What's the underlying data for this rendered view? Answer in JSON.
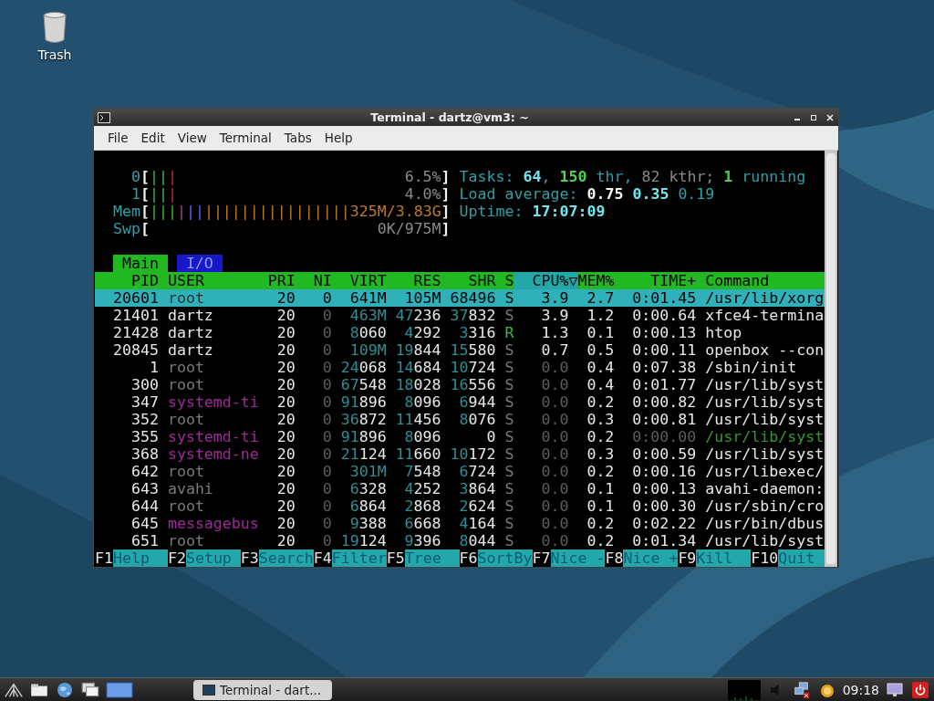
{
  "desktop_icons": [
    {
      "label": "Trash"
    }
  ],
  "window": {
    "title": "Terminal - dartz@vm3: ~",
    "menu": [
      "File",
      "Edit",
      "View",
      "Terminal",
      "Tabs",
      "Help"
    ]
  },
  "meters": [
    {
      "label": "0",
      "open": "[",
      "close": "]",
      "value": "6.5%",
      "segments": [
        {
          "kind": "normal",
          "text": "||"
        },
        {
          "kind": "kernel",
          "text": "|"
        }
      ]
    },
    {
      "label": "1",
      "open": "[",
      "close": "]",
      "value": "4.0%",
      "segments": [
        {
          "kind": "normal",
          "text": "||"
        },
        {
          "kind": "kernel",
          "text": "|"
        }
      ]
    },
    {
      "label": "Mem",
      "open": "[",
      "close": "]",
      "value": "325M/3.83G",
      "segments": [
        {
          "kind": "normal",
          "text": "|||"
        },
        {
          "kind": "shared",
          "text": "|"
        },
        {
          "kind": "buffers",
          "text": "||"
        },
        {
          "kind": "cache",
          "text": "||||||||||||||||"
        }
      ]
    },
    {
      "label": "Swp",
      "open": "[",
      "close": "]",
      "value": "0K/975M"
    }
  ],
  "info": [
    {
      "segments": [
        {
          "text": "Tasks: ",
          "kind": "label"
        },
        {
          "text": "64",
          "kind": "value"
        },
        {
          "text": ", ",
          "kind": "label"
        },
        {
          "text": "150",
          "kind": "green"
        },
        {
          "text": " thr, ",
          "kind": "label"
        },
        {
          "text": "82 kthr; ",
          "kind": "dim"
        },
        {
          "text": "1",
          "kind": "green"
        },
        {
          "text": " running",
          "kind": "label"
        }
      ]
    },
    {
      "segments": [
        {
          "text": "Load average: ",
          "kind": "label"
        },
        {
          "text": "0.75 ",
          "kind": "bright"
        },
        {
          "text": "0.35 ",
          "kind": "value"
        },
        {
          "text": "0.19",
          "kind": "label"
        }
      ]
    },
    {
      "segments": [
        {
          "text": "Uptime: ",
          "kind": "label"
        },
        {
          "text": "17:07:09",
          "kind": "value"
        }
      ]
    }
  ],
  "tabs": [
    {
      "label": "Main",
      "selected": true
    },
    {
      "label": "I/O",
      "selected": false
    }
  ],
  "table": {
    "columns": [
      {
        "label": "PID",
        "sorted": false
      },
      {
        "label": "USER",
        "sorted": false
      },
      {
        "label": "PRI",
        "sorted": false
      },
      {
        "label": "NI",
        "sorted": false
      },
      {
        "label": "VIRT",
        "sorted": false
      },
      {
        "label": "RES",
        "sorted": false
      },
      {
        "label": "SHR",
        "sorted": false
      },
      {
        "label": "S",
        "sorted": false
      },
      {
        "label": "CPU%▽",
        "sorted": true
      },
      {
        "label": "MEM%",
        "sorted": false
      },
      {
        "label": "TIME+",
        "sorted": false
      },
      {
        "label": "Command",
        "sorted": false
      }
    ],
    "rows": [
      {
        "cells": [
          "20601",
          "root",
          "20",
          "0",
          "641M",
          "105M",
          "68496",
          "S",
          "3.9",
          "2.7",
          "0:01.45",
          "/usr/lib/xorg"
        ],
        "selected": true,
        "running": false,
        "thread": false,
        "kind": "other"
      },
      {
        "cells": [
          "21401",
          "dartz",
          "20",
          "0",
          "463M",
          "47236",
          "37832",
          "S",
          "3.9",
          "1.2",
          "0:00.64",
          "xfce4-termina"
        ],
        "selected": false,
        "running": false,
        "thread": false,
        "kind": "self"
      },
      {
        "cells": [
          "21428",
          "dartz",
          "20",
          "0",
          "8060",
          "4292",
          "3316",
          "R",
          "1.3",
          "0.1",
          "0:00.13",
          "htop"
        ],
        "selected": false,
        "running": true,
        "thread": false,
        "kind": "self"
      },
      {
        "cells": [
          "20845",
          "dartz",
          "20",
          "0",
          "109M",
          "19844",
          "15580",
          "S",
          "0.7",
          "0.5",
          "0:00.11",
          "openbox --con"
        ],
        "selected": false,
        "running": false,
        "thread": false,
        "kind": "self"
      },
      {
        "cells": [
          "1",
          "root",
          "20",
          "0",
          "24068",
          "14684",
          "10724",
          "S",
          "0.0",
          "0.4",
          "0:07.38",
          "/sbin/init"
        ],
        "selected": false,
        "running": false,
        "thread": false,
        "kind": "other"
      },
      {
        "cells": [
          "300",
          "root",
          "20",
          "0",
          "67548",
          "18028",
          "16556",
          "S",
          "0.0",
          "0.4",
          "0:01.77",
          "/usr/lib/syst"
        ],
        "selected": false,
        "running": false,
        "thread": false,
        "kind": "other"
      },
      {
        "cells": [
          "347",
          "systemd-ti",
          "20",
          "0",
          "91896",
          "8096",
          "6944",
          "S",
          "0.0",
          "0.2",
          "0:00.82",
          "/usr/lib/syst"
        ],
        "selected": false,
        "running": false,
        "thread": false,
        "kind": "service"
      },
      {
        "cells": [
          "352",
          "root",
          "20",
          "0",
          "36872",
          "11456",
          "8076",
          "S",
          "0.0",
          "0.3",
          "0:00.81",
          "/usr/lib/syst"
        ],
        "selected": false,
        "running": false,
        "thread": false,
        "kind": "other"
      },
      {
        "cells": [
          "355",
          "systemd-ti",
          "20",
          "0",
          "91896",
          "8096",
          "0",
          "S",
          "0.0",
          "0.2",
          "0:00.00",
          "/usr/lib/syst"
        ],
        "selected": false,
        "running": false,
        "thread": true,
        "kind": "service"
      },
      {
        "cells": [
          "368",
          "systemd-ne",
          "20",
          "0",
          "21124",
          "11660",
          "10172",
          "S",
          "0.0",
          "0.3",
          "0:00.59",
          "/usr/lib/syst"
        ],
        "selected": false,
        "running": false,
        "thread": false,
        "kind": "service"
      },
      {
        "cells": [
          "642",
          "root",
          "20",
          "0",
          "301M",
          "7548",
          "6724",
          "S",
          "0.0",
          "0.2",
          "0:00.16",
          "/usr/libexec/"
        ],
        "selected": false,
        "running": false,
        "thread": false,
        "kind": "other"
      },
      {
        "cells": [
          "643",
          "avahi",
          "20",
          "0",
          "6328",
          "4252",
          "3864",
          "S",
          "0.0",
          "0.1",
          "0:00.13",
          "avahi-daemon:"
        ],
        "selected": false,
        "running": false,
        "thread": false,
        "kind": "other"
      },
      {
        "cells": [
          "644",
          "root",
          "20",
          "0",
          "6864",
          "2868",
          "2624",
          "S",
          "0.0",
          "0.1",
          "0:00.30",
          "/usr/sbin/cro"
        ],
        "selected": false,
        "running": false,
        "thread": false,
        "kind": "other"
      },
      {
        "cells": [
          "645",
          "messagebus",
          "20",
          "0",
          "9388",
          "6668",
          "4164",
          "S",
          "0.0",
          "0.2",
          "0:02.22",
          "/usr/bin/dbus"
        ],
        "selected": false,
        "running": false,
        "thread": false,
        "kind": "service"
      },
      {
        "cells": [
          "651",
          "root",
          "20",
          "0",
          "19124",
          "9396",
          "8044",
          "S",
          "0.0",
          "0.2",
          "0:01.34",
          "/usr/lib/syst"
        ],
        "selected": false,
        "running": false,
        "thread": false,
        "kind": "other"
      }
    ]
  },
  "function_keys": [
    {
      "key": "F1",
      "label": "Help"
    },
    {
      "key": "F2",
      "label": "Setup"
    },
    {
      "key": "F3",
      "label": "Search"
    },
    {
      "key": "F4",
      "label": "Filter"
    },
    {
      "key": "F5",
      "label": "Tree"
    },
    {
      "key": "F6",
      "label": "SortBy"
    },
    {
      "key": "F7",
      "label": "Nice -"
    },
    {
      "key": "F8",
      "label": "Nice +"
    },
    {
      "key": "F9",
      "label": "Kill"
    },
    {
      "key": "F10",
      "label": "Quit"
    }
  ],
  "taskbar": {
    "task": "Terminal - dart...",
    "clock": "09:18"
  }
}
